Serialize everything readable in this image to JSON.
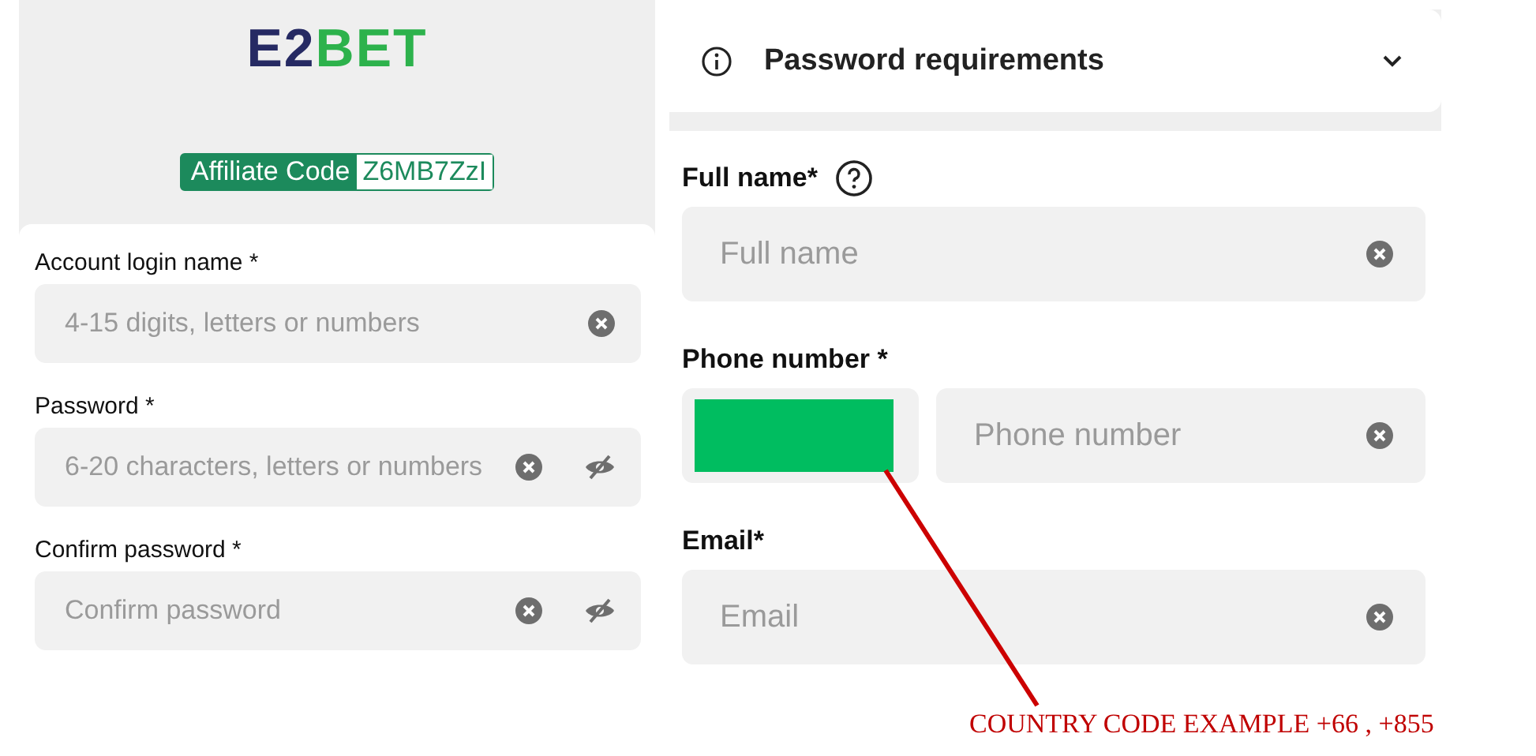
{
  "logo": {
    "parts": [
      "E2",
      "BET"
    ]
  },
  "affiliate": {
    "label": "Affiliate Code",
    "code": "Z6MB7ZzI"
  },
  "left_form": {
    "fields": [
      {
        "kind": "text",
        "label": "Account login name *",
        "placeholder": "4-15 digits, letters or numbers"
      },
      {
        "kind": "password",
        "label": "Password *",
        "placeholder": "6-20 characters, letters or numbers"
      },
      {
        "kind": "password",
        "label": "Confirm password *",
        "placeholder": "Confirm password"
      }
    ]
  },
  "password_requirements": {
    "title": "Password requirements",
    "expanded": false
  },
  "right_form": {
    "fields": [
      {
        "kind": "text",
        "label": "Full name*",
        "help": true,
        "placeholder": "Full name"
      },
      {
        "kind": "phone",
        "label": "Phone number *",
        "help": false,
        "placeholder": "Phone number"
      },
      {
        "kind": "text",
        "label": "Email*",
        "help": false,
        "placeholder": "Email"
      }
    ]
  },
  "annotation": {
    "text": "COUNTRY CODE EXAMPLE +66 , +855"
  }
}
